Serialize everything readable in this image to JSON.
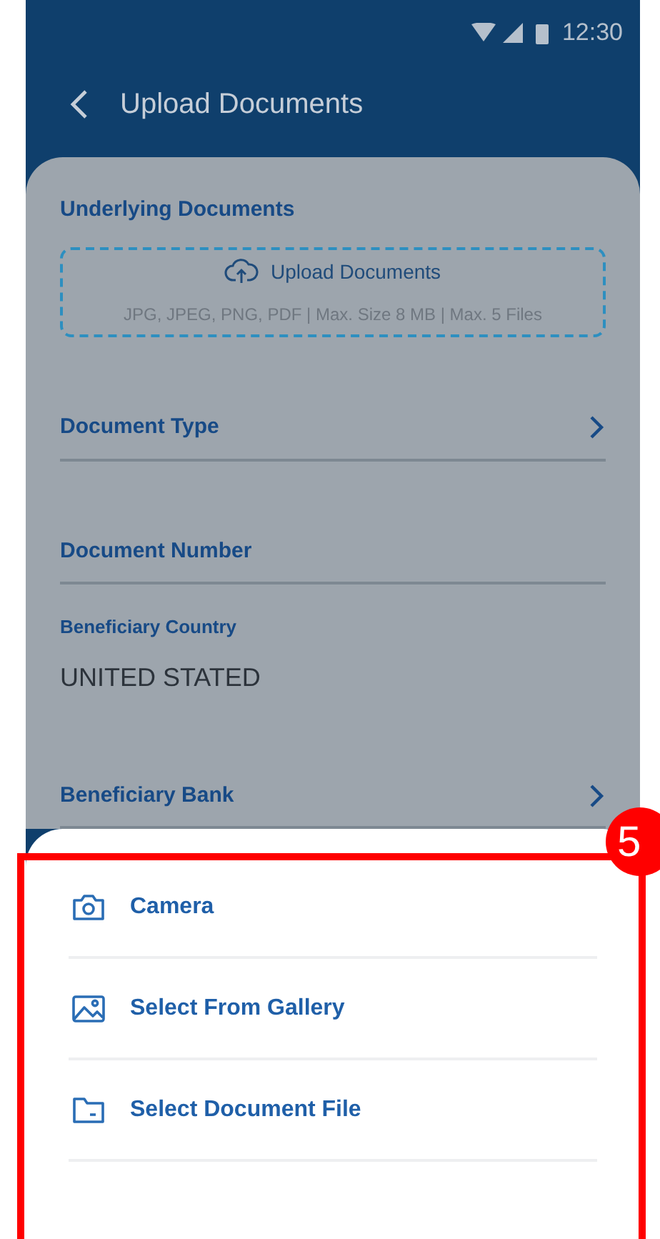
{
  "status_bar": {
    "time": "12:30"
  },
  "header": {
    "title": "Upload Documents"
  },
  "form": {
    "section_title": "Underlying Documents",
    "upload": {
      "label": "Upload Documents",
      "hint": "JPG, JPEG, PNG, PDF | Max. Size 8 MB | Max. 5 Files"
    },
    "fields": [
      {
        "kind": "select",
        "label": "Document Type"
      },
      {
        "kind": "input",
        "label": "Document Number"
      },
      {
        "kind": "value",
        "label": "Beneficiary Country",
        "value": "UNITED STATED"
      },
      {
        "kind": "select",
        "label": "Beneficiary Bank"
      }
    ]
  },
  "sheet": {
    "options": [
      {
        "kind": "camera",
        "label": "Camera"
      },
      {
        "kind": "gallery",
        "label": "Select From Gallery"
      },
      {
        "kind": "file",
        "label": "Select Document File"
      }
    ]
  },
  "annotation": {
    "badge": "5"
  }
}
